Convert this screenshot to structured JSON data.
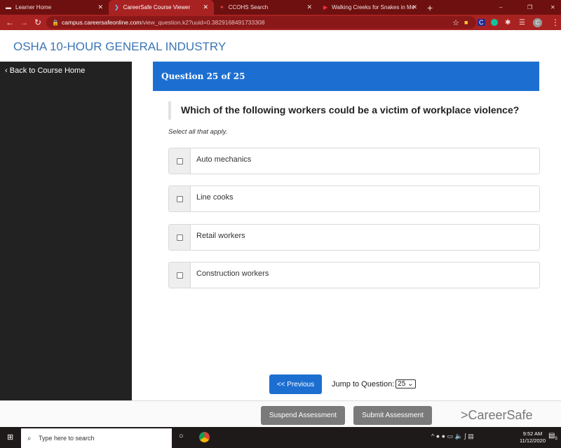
{
  "browser": {
    "tabs": [
      {
        "label": "Learner Home",
        "active": false
      },
      {
        "label": "CareerSafe Course Viewer",
        "active": true
      },
      {
        "label": "CCOHS Search",
        "active": false
      },
      {
        "label": "Walking Creeks for Snakes in Me",
        "active": false
      }
    ],
    "url_domain": "campus.careersafeonline.com",
    "url_path": "/view_question.k2?uuid=0.3829168491733308",
    "profile_initial": "C"
  },
  "page": {
    "title": "OSHA 10-HOUR GENERAL INDUSTRY",
    "back_link": "Back to Course Home",
    "question_header": "Question 25 of 25",
    "question": "Which of the following workers could be a victim of workplace violence?",
    "hint": "Select all that apply.",
    "options": [
      {
        "label": "Auto mechanics",
        "checked": false
      },
      {
        "label": "Line cooks",
        "checked": false
      },
      {
        "label": "Retail workers",
        "checked": false
      },
      {
        "label": "Construction workers",
        "checked": false
      }
    ],
    "previous_label": "<< Previous",
    "jump_label": "Jump to Question:",
    "jump_value": "25",
    "suspend_label": "Suspend Assessment",
    "submit_label": "Submit Assessment",
    "logo_text": "CareerSafe",
    "accent_color": "#1c6fd1"
  },
  "taskbar": {
    "search_placeholder": "Type here to search",
    "time": "9:52 AM",
    "date": "11/12/2020",
    "notification_count": "5"
  }
}
